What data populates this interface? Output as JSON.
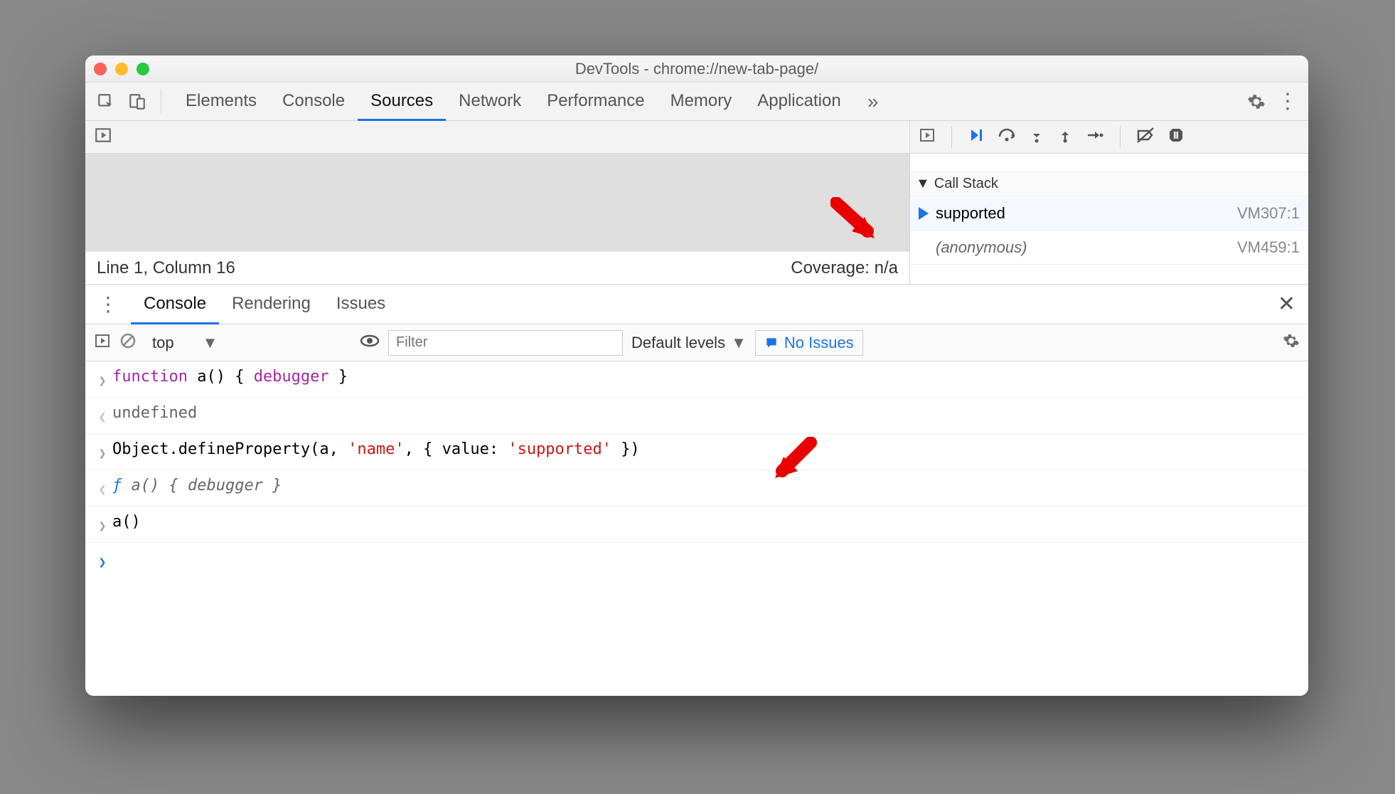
{
  "window": {
    "title": "DevTools - chrome://new-tab-page/"
  },
  "main_tabs": [
    "Elements",
    "Console",
    "Sources",
    "Network",
    "Performance",
    "Memory",
    "Application"
  ],
  "main_tab_active": 2,
  "sources": {
    "status_left": "Line 1, Column 16",
    "status_right": "Coverage: n/a"
  },
  "call_stack": {
    "header": "Call Stack",
    "frames": [
      {
        "name": "supported",
        "location": "VM307:1",
        "current": true,
        "italic": false
      },
      {
        "name": "(anonymous)",
        "location": "VM459:1",
        "current": false,
        "italic": true
      }
    ]
  },
  "drawer_tabs": [
    "Console",
    "Rendering",
    "Issues"
  ],
  "drawer_tab_active": 0,
  "console_toolbar": {
    "context": "top",
    "filter_placeholder": "Filter",
    "levels_label": "Default levels",
    "issues_label": "No Issues"
  },
  "console_entries": [
    {
      "type": "in",
      "segments": [
        {
          "t": "function",
          "cls": "kw"
        },
        {
          "t": " a() { "
        },
        {
          "t": "debugger",
          "cls": "kw"
        },
        {
          "t": " }"
        }
      ]
    },
    {
      "type": "out",
      "segments": [
        {
          "t": "undefined",
          "cls": "undef"
        }
      ]
    },
    {
      "type": "in",
      "segments": [
        {
          "t": "Object.defineProperty(a, "
        },
        {
          "t": "'name'",
          "cls": "str"
        },
        {
          "t": ", { value: "
        },
        {
          "t": "'supported'",
          "cls": "str"
        },
        {
          "t": " })"
        }
      ]
    },
    {
      "type": "out-fn",
      "segments": [
        {
          "t": "ƒ ",
          "cls": "fsym"
        },
        {
          "t": "a() { debugger }"
        }
      ]
    },
    {
      "type": "in",
      "segments": [
        {
          "t": "a()"
        }
      ]
    }
  ]
}
